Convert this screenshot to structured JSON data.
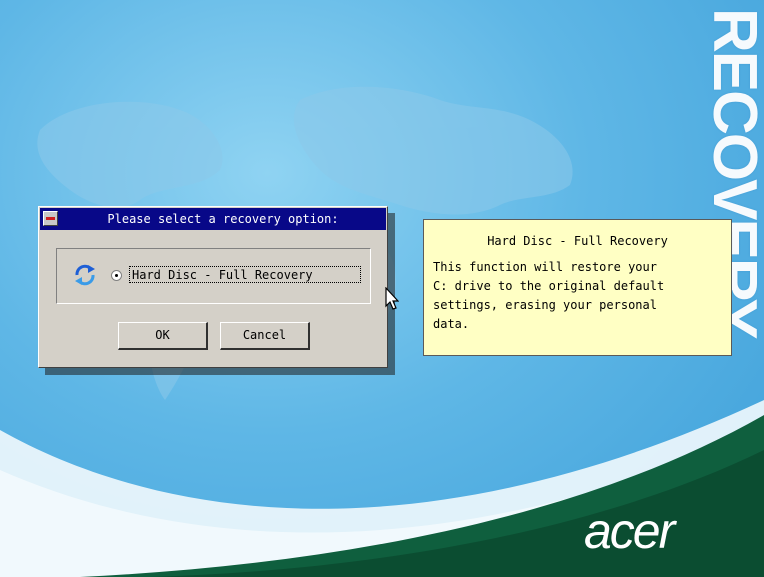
{
  "brand": {
    "word": "RECOVERY",
    "logo": "acer",
    "colors": {
      "sky": "#5fb7e6",
      "swoosh_light": "#eef7fc",
      "swoosh_green": "#0f5f3e"
    }
  },
  "dialog": {
    "title": "Please select a recovery option:",
    "option": {
      "label": "Hard Disc - Full Recovery",
      "selected": true,
      "icon": "recovery-arrows-icon"
    },
    "ok_label": "OK",
    "cancel_label": "Cancel"
  },
  "info": {
    "title": "Hard Disc - Full Recovery",
    "body": "This function will restore your\nC: drive to the original default\nsettings, erasing your personal\ndata."
  }
}
